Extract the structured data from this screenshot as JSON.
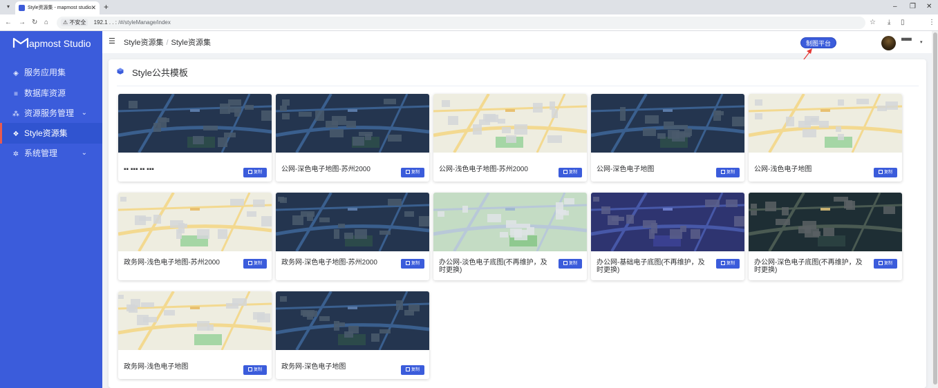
{
  "browser": {
    "tab_title": "Style资源集 - mapmost studio",
    "tab_close": "✕",
    "new_tab": "+",
    "win_minimize": "‒",
    "win_restore": "❐",
    "win_close": "✕",
    "back": "←",
    "forward": "→",
    "reload": "↻",
    "home": "⌂",
    "security_warning": "⚠ 不安全",
    "url_host": "192.1 . . :",
    "url_path": "/#/styleManage/index",
    "bar_icons": [
      "☆",
      "⤓",
      "▯",
      "⋮"
    ]
  },
  "sidebar": {
    "logo_text": "apmost Studio",
    "items": [
      {
        "label": "服务应用集",
        "icon": "layers-icon",
        "glyph": "◈",
        "active": false,
        "expandable": false
      },
      {
        "label": "数据库资源",
        "icon": "database-icon",
        "glyph": "≡",
        "active": false,
        "expandable": false
      },
      {
        "label": "资源服务管理",
        "icon": "cluster-icon",
        "glyph": "⁂",
        "active": false,
        "expandable": true
      },
      {
        "label": "Style资源集",
        "icon": "cube-icon",
        "glyph": "❖",
        "active": true,
        "expandable": false
      },
      {
        "label": "系统管理",
        "icon": "gear-icon",
        "glyph": "✲",
        "active": false,
        "expandable": true
      }
    ],
    "chevron": "⌄"
  },
  "header": {
    "menu_toggle": "☰",
    "breadcrumb": [
      "Style资源集",
      "Style资源集"
    ],
    "breadcrumb_sep": "/",
    "platform_button": "制图平台",
    "user_name": "▀▀▀",
    "user_caret": "▾"
  },
  "panel": {
    "title": "Style公共模板"
  },
  "copy_label": "复制",
  "cards": [
    {
      "label": "▪▪ ▪▪▪ ▪▪ ▪▪▪",
      "thumb": "dark"
    },
    {
      "label": "公网-深色电子地图-苏州2000",
      "thumb": "dark"
    },
    {
      "label": "公网-浅色电子地图-苏州2000",
      "thumb": "light"
    },
    {
      "label": "公网-深色电子地图",
      "thumb": "dark"
    },
    {
      "label": "公网-浅色电子地图",
      "thumb": "light"
    },
    {
      "label": "政务网-浅色电子地图-苏州2000",
      "thumb": "light"
    },
    {
      "label": "政务网-深色电子地图-苏州2000",
      "thumb": "dark"
    },
    {
      "label": "办公网-淡色电子底图(不再维护，及时更换)",
      "thumb": "green"
    },
    {
      "label": "办公网-基础电子底图(不再维护，及时更换)",
      "thumb": "purple"
    },
    {
      "label": "办公网-深色电子底图(不再维护，及时更换)",
      "thumb": "tealdark"
    },
    {
      "label": "政务网-浅色电子地图",
      "thumb": "light"
    },
    {
      "label": "政务网-深色电子地图",
      "thumb": "dark"
    }
  ],
  "colors": {
    "sidebar": "#3b5cdb",
    "accent": "#3b5cdb",
    "active_marker": "#e85a4f",
    "annotation_arrow": "#e53935"
  }
}
